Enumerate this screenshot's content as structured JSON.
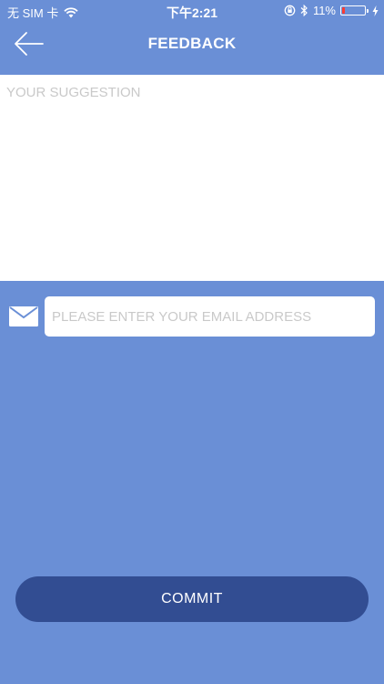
{
  "status_bar": {
    "carrier": "无 SIM 卡",
    "time": "下午2:21",
    "battery_percent": "11%",
    "battery_level": 0.11,
    "icons": [
      "wifi-icon",
      "rotation-lock-icon",
      "bluetooth-icon",
      "battery-icon",
      "charging-icon"
    ]
  },
  "header": {
    "title": "FEEDBACK",
    "back_icon": "arrow-left-icon"
  },
  "form": {
    "suggestion_placeholder": "YOUR SUGGESTION",
    "suggestion_value": "",
    "email_placeholder": "PLEASE ENTER YOUR EMAIL ADDRESS",
    "email_value": "",
    "email_icon": "envelope-icon",
    "commit_label": "COMMIT"
  },
  "colors": {
    "background": "#6a8fd6",
    "button": "#324d92",
    "placeholder": "#c9c9c9",
    "battery_low": "#ff3b30"
  }
}
